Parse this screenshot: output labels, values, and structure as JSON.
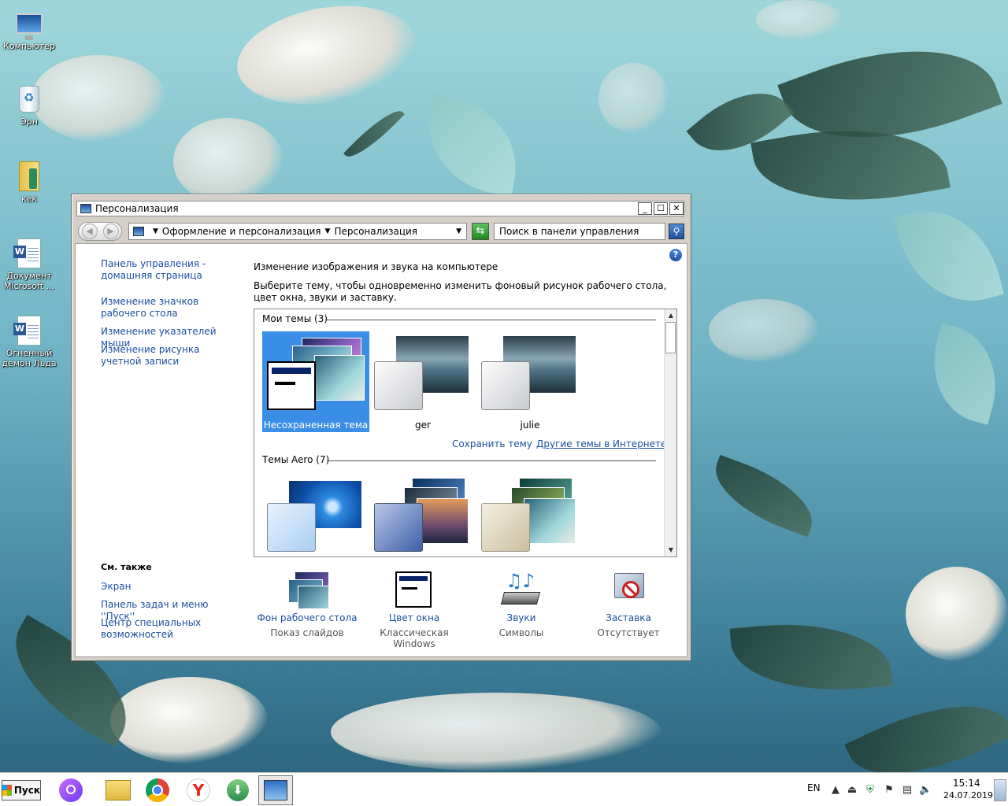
{
  "desktop": {
    "icons": [
      {
        "label": "Компьютер"
      },
      {
        "label": "Эрн"
      },
      {
        "label": "кек"
      },
      {
        "label": "Документ Microsoft ..."
      },
      {
        "label": "Огненный демон Льда"
      }
    ]
  },
  "window": {
    "title": "Персонализация",
    "controls": {
      "minimize": "_",
      "maximize": "☐",
      "close": "✕"
    },
    "address": {
      "segments": [
        "Оформление и персонализация",
        "Персонализация"
      ]
    },
    "search": {
      "placeholder": "Поиск в панели управления"
    },
    "sidebar": {
      "links": [
        "Панель управления - домашняя страница",
        "Изменение значков рабочего стола",
        "Изменение указателей мыши",
        "Изменение рисунка учетной записи"
      ],
      "see_also_title": "См. также",
      "see_also": [
        "Экран",
        "Панель задач и меню ''Пуск''",
        "Центр специальных возможностей"
      ]
    },
    "main": {
      "title": "Изменение изображения и звука на компьютере",
      "description": "Выберите тему, чтобы одновременно изменить фоновый рисунок рабочего стола, цвет окна, звуки и заставку.",
      "my_themes_header": "Мои темы (3)",
      "my_themes": [
        {
          "name": "Несохраненная тема",
          "selected": true
        },
        {
          "name": "ger",
          "selected": false
        },
        {
          "name": "julie",
          "selected": false
        }
      ],
      "save_theme": "Сохранить тему",
      "more_themes": "Другие темы в Интернете",
      "aero_header": "Темы Aero (7)"
    },
    "bottom": [
      {
        "label": "Фон рабочего стола",
        "sub": "Показ слайдов"
      },
      {
        "label": "Цвет окна",
        "sub": "Классическая Windows"
      },
      {
        "label": "Звуки",
        "sub": "Символы"
      },
      {
        "label": "Заставка",
        "sub": "Отсутствует"
      }
    ]
  },
  "taskbar": {
    "start_label": "Пуск",
    "language": "EN",
    "time": "15:14",
    "date": "24.07.2019"
  },
  "colors": {
    "selection": "#3a8ee6",
    "link": "#1a4ea0"
  }
}
